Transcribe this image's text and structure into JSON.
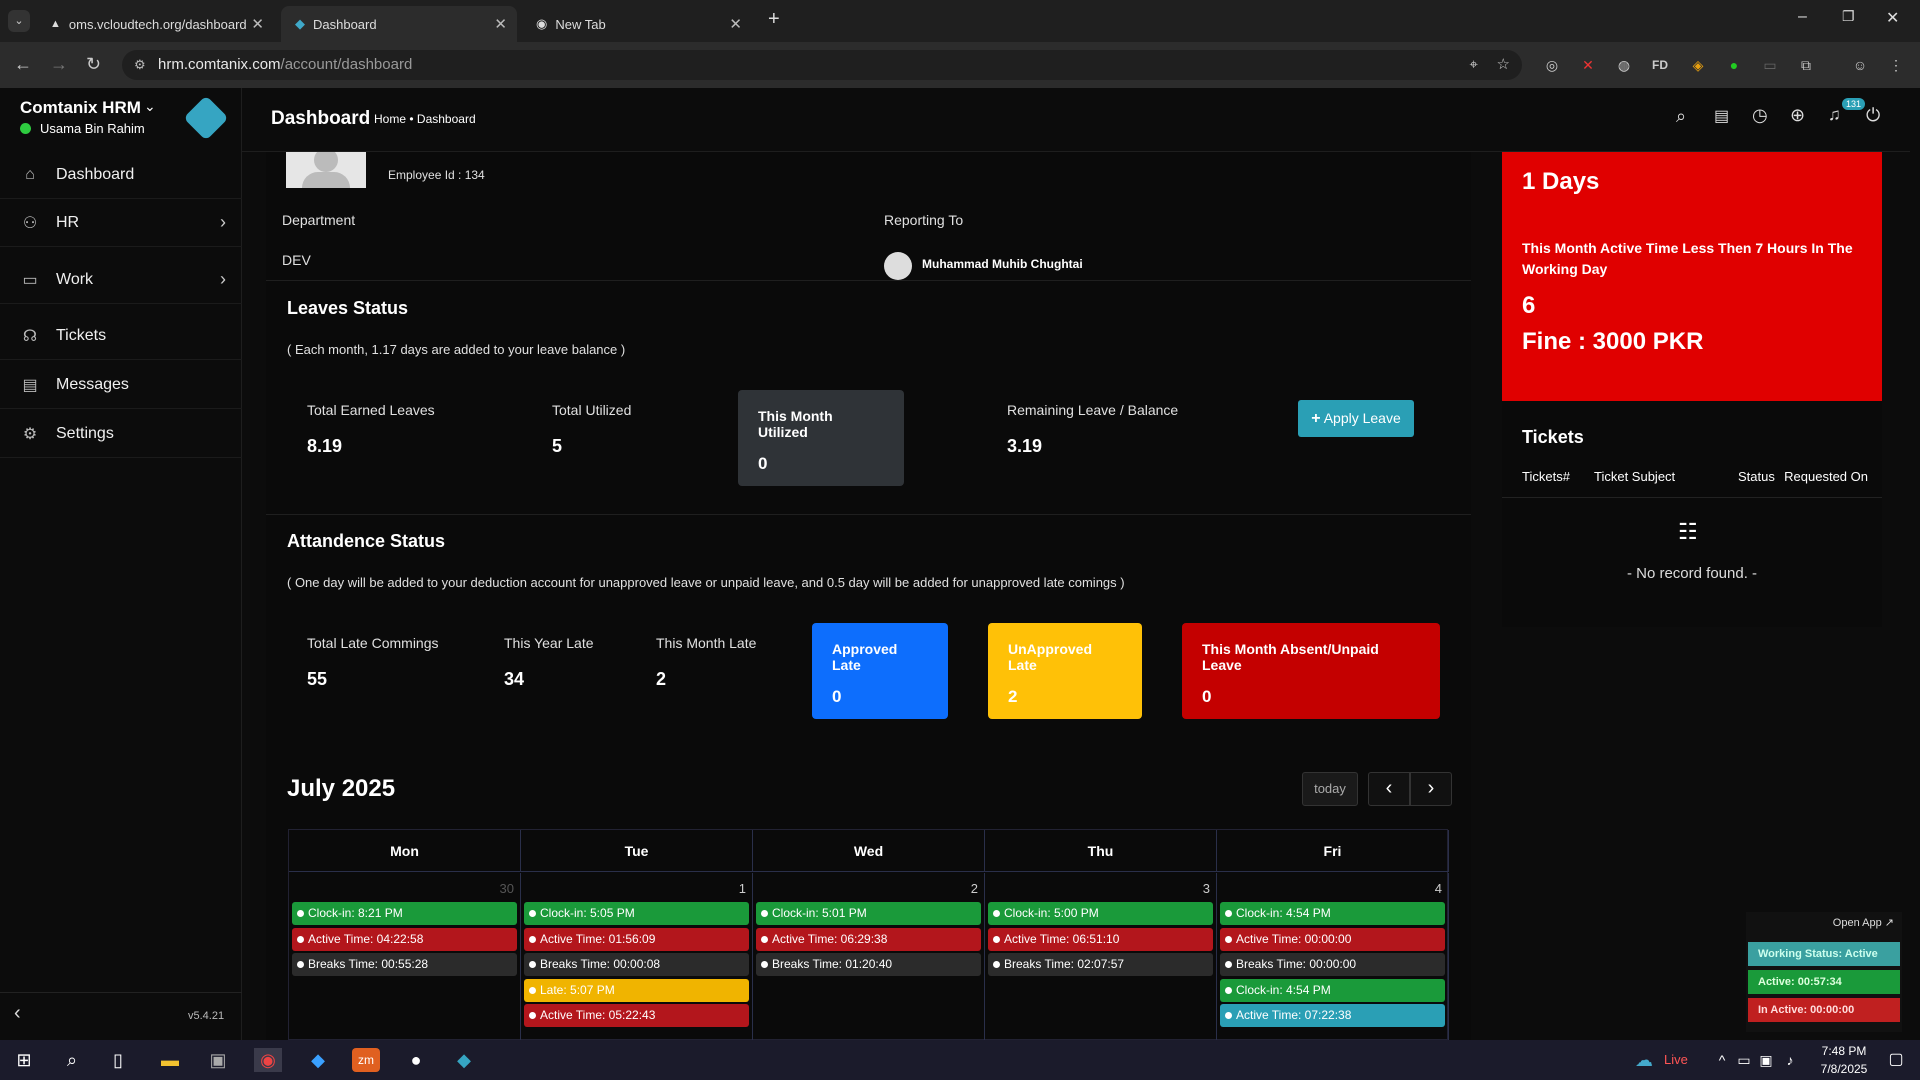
{
  "browser": {
    "tabs": [
      {
        "label": "oms.vcloudtech.org/dashboard",
        "active": false
      },
      {
        "label": "Dashboard",
        "active": true
      },
      {
        "label": "New Tab",
        "active": false
      }
    ],
    "url_host": "hrm.comtanix.com",
    "url_path": "/account/dashboard"
  },
  "sidebar": {
    "company": "Comtanix HRM",
    "user": "Usama Bin Rahim",
    "version": "v5.4.21",
    "items": [
      {
        "label": "Dashboard",
        "icon": "home-icon"
      },
      {
        "label": "HR",
        "icon": "users-icon"
      },
      {
        "label": "Work",
        "icon": "briefcase-icon"
      },
      {
        "label": "Tickets",
        "icon": "headset-icon"
      },
      {
        "label": "Messages",
        "icon": "message-icon"
      },
      {
        "label": "Settings",
        "icon": "gear-icon"
      }
    ]
  },
  "header": {
    "title": "Dashboard",
    "breadcrumb_home": "Home",
    "breadcrumb_sep": "•",
    "breadcrumb_current": "Dashboard",
    "notification_count": "131"
  },
  "profile": {
    "employee_id": "Employee Id : 134",
    "department_label": "Department",
    "department_value": "DEV",
    "reporting_label": "Reporting To",
    "reporting_value": "Muhammad Muhib Chughtai"
  },
  "leaves": {
    "title": "Leaves Status",
    "note": "( Each month, 1.17 days are added to your leave balance )",
    "total_earned_label": "Total Earned Leaves",
    "total_earned_value": "8.19",
    "total_utilized_label": "Total Utilized",
    "total_utilized_value": "5",
    "month_utilized_label": "This Month Utilized",
    "month_utilized_value": "0",
    "remaining_label": "Remaining Leave / Balance",
    "remaining_value": "3.19",
    "apply_button": "Apply Leave"
  },
  "attendance": {
    "title": "Attandence Status",
    "note": "( One day will be added to your deduction account for unapproved leave or unpaid leave, and 0.5 day will be added for unapproved late comings )",
    "total_late_label": "Total Late Commings",
    "total_late_value": "55",
    "year_late_label": "This Year Late",
    "year_late_value": "34",
    "month_late_label": "This Month Late",
    "month_late_value": "2",
    "approved_label": "Approved Late",
    "approved_value": "0",
    "unapproved_label": "UnApproved Late",
    "unapproved_value": "2",
    "absent_label": "This Month Absent/Unpaid Leave",
    "absent_value": "0",
    "colors": {
      "approved": "#0d6efd",
      "unapproved": "#ffc107",
      "absent": "#c40000"
    }
  },
  "calendar": {
    "month": "July 2025",
    "today_button": "today",
    "days": [
      {
        "name": "Mon",
        "num": "30",
        "events": [
          {
            "text": "Clock-in: 8:21 PM",
            "color": "green"
          },
          {
            "text": "Active Time: 04:22:58",
            "color": "red"
          },
          {
            "text": "Breaks Time: 00:55:28",
            "color": "gray"
          }
        ]
      },
      {
        "name": "Tue",
        "num": "1",
        "events": [
          {
            "text": "Clock-in: 5:05 PM",
            "color": "green"
          },
          {
            "text": "Active Time: 01:56:09",
            "color": "red"
          },
          {
            "text": "Breaks Time: 00:00:08",
            "color": "gray"
          },
          {
            "text": "Late: 5:07 PM",
            "color": "yellow"
          },
          {
            "text": "Active Time: 05:22:43",
            "color": "red"
          }
        ]
      },
      {
        "name": "Wed",
        "num": "2",
        "events": [
          {
            "text": "Clock-in: 5:01 PM",
            "color": "green"
          },
          {
            "text": "Active Time: 06:29:38",
            "color": "red"
          },
          {
            "text": "Breaks Time: 01:20:40",
            "color": "gray"
          }
        ]
      },
      {
        "name": "Thu",
        "num": "3",
        "events": [
          {
            "text": "Clock-in: 5:00 PM",
            "color": "green"
          },
          {
            "text": "Active Time: 06:51:10",
            "color": "red"
          },
          {
            "text": "Breaks Time: 02:07:57",
            "color": "gray"
          }
        ]
      },
      {
        "name": "Fri",
        "num": "4",
        "events": [
          {
            "text": "Clock-in: 4:54 PM",
            "color": "green"
          },
          {
            "text": "Active Time: 00:00:00",
            "color": "red"
          },
          {
            "text": "Breaks Time: 00:00:00",
            "color": "gray"
          },
          {
            "text": "Clock-in: 4:54 PM",
            "color": "green"
          },
          {
            "text": "Active Time: 07:22:38",
            "color": "cyan"
          }
        ]
      }
    ]
  },
  "fine_card": {
    "days": "1 Days",
    "message": "This Month Active Time Less Then 7 Hours In The Working Day",
    "count": "6",
    "fine": "Fine : 3000 PKR"
  },
  "tickets": {
    "title": "Tickets",
    "columns": [
      "Tickets#",
      "Ticket Subject",
      "Status",
      "Requested On"
    ],
    "empty": "- No record found. -"
  },
  "status_widget": {
    "open_app": "Open App ↗",
    "working_status": "Working Status: Active",
    "active": "Active: 00:57:34",
    "inactive": "In Active: 00:00:00"
  },
  "taskbar": {
    "weather": "Live",
    "time": "7:48 PM",
    "date": "7/8/2025"
  }
}
